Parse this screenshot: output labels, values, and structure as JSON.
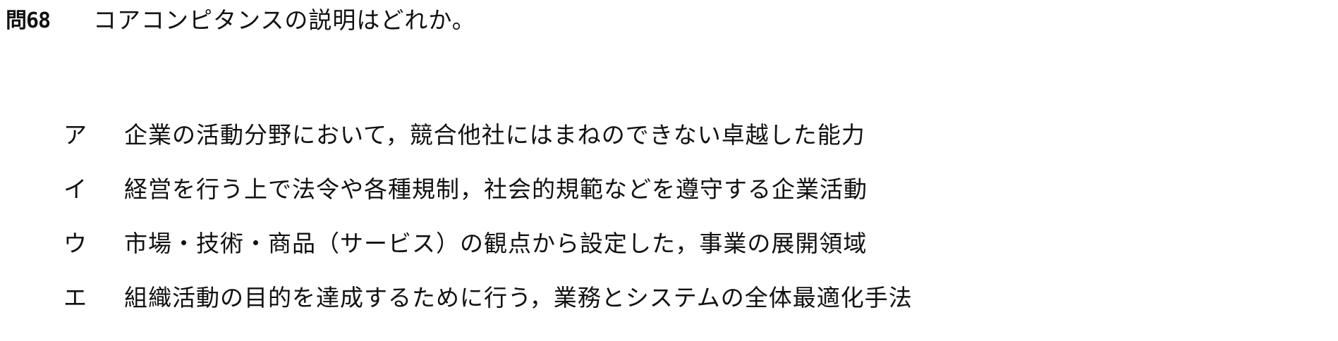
{
  "question": {
    "number": "問68",
    "text": "コアコンピタンスの説明はどれか。"
  },
  "choices": [
    {
      "label": "ア",
      "text": "企業の活動分野において，競合他社にはまねのできない卓越した能力"
    },
    {
      "label": "イ",
      "text": "経営を行う上で法令や各種規制，社会的規範などを遵守する企業活動"
    },
    {
      "label": "ウ",
      "text": "市場・技術・商品（サービス）の観点から設定した，事業の展開領域"
    },
    {
      "label": "エ",
      "text": "組織活動の目的を達成するために行う，業務とシステムの全体最適化手法"
    }
  ]
}
